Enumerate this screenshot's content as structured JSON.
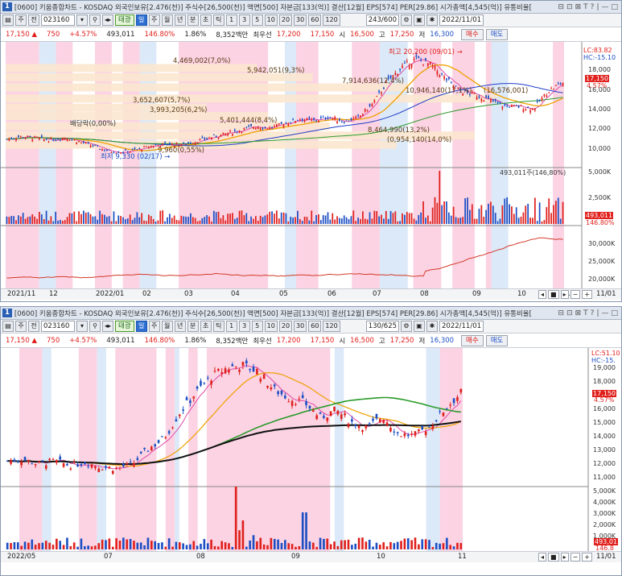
{
  "titlebar": {
    "num": "1",
    "text": "[0600] 키움종합차트 - KOSDAQ 외국인보유[2.476(천)] 주식수[26,500(천)] 액면[500] 자본금[133(억)] 결산[12월] EPS[574] PER[29.86] 시가총액[4,545(억)] 유통비율[",
    "controls": [
      "⊟",
      "⊡",
      "⊠",
      "T",
      "?",
      "|",
      "—",
      "□"
    ]
  },
  "toolbar": {
    "code": "023160",
    "name": "태광",
    "sys1": "주",
    "sys2": "전",
    "periods": [
      "일",
      "주",
      "월",
      "년",
      "분",
      "초",
      "틱"
    ],
    "minutes": [
      "1",
      "3",
      "5",
      "10",
      "20",
      "30",
      "60",
      "120"
    ],
    "date": "2022/11/01"
  },
  "toolbar1_count": "243/600",
  "toolbar2_count": "130/625",
  "quote": {
    "price": "17,150",
    "arrow": "▲",
    "change": "750",
    "pct": "+4.57%",
    "volume": "493,011",
    "vol_ratio": "146.80%",
    "turnover": "1.86%",
    "amount": "8,352백만",
    "best_ask_label": "최우선",
    "ask": "17,200",
    "bid": "17,150",
    "open_label": "시",
    "open": "16,500",
    "high_label": "고",
    "high": "17,250",
    "low_label": "저",
    "low": "16,300",
    "buy": "매수",
    "sell": "매도"
  },
  "chart1": {
    "annotations": {
      "high": "최고 20,200 (09/01) →",
      "low": "최저 9,330 (02/17) →",
      "dividend": "배당락(0,00%)",
      "lc": "LC:83.82",
      "hc": "HC:-15.10",
      "price_pct": "4.57%"
    },
    "volume_level_labels": [
      {
        "text": "4,469,002(7,0%)"
      },
      {
        "text": "5,942,051(9,3%)"
      },
      {
        "text": "7,914,636(12,4%)"
      },
      {
        "text": "10,946,140(17,1%)"
      },
      {
        "text": "(16,576,001)"
      },
      {
        "text": "3,652,607(5,7%)"
      },
      {
        "text": "3,993,205(6,2%)"
      },
      {
        "text": "5,401,444(8,4%)"
      },
      {
        "text": "8,464,990(13,2%)"
      },
      {
        "text": "(0,954,140(14,0%)"
      },
      {
        "text": "9,960(0,55%)"
      }
    ],
    "price_axis": [
      "18,000",
      "16,000",
      "14,000",
      "12,000",
      "10,000"
    ],
    "price_tag": "17,150",
    "volume_info": "493,011주(146,80%)",
    "volume_axis": [
      "5,000K",
      "2,500K"
    ],
    "volume_tag": "493,011",
    "volume_tag2": "146.80%",
    "obv_axis": [
      "30,000K",
      "25,000K",
      "20,000K"
    ],
    "date_axis": [
      "2021/11",
      "12",
      "2022/01",
      "02",
      "03",
      "04",
      "05",
      "06",
      "07",
      "08",
      "09",
      "10",
      "11",
      "11/01"
    ]
  },
  "chart2": {
    "price_axis": [
      "19,000",
      "18,000",
      "17,000",
      "16,000",
      "15,000",
      "14,000",
      "13,000",
      "12,000",
      "11,000"
    ],
    "lc": "LC:51.10",
    "hc": "HC:-15.",
    "price_tag": "17,150",
    "price_pct": "4.57%",
    "volume_axis": [
      "5,000K",
      "4,000K",
      "3,000K",
      "2,000K",
      "1,000K"
    ],
    "volume_tag": "493,01",
    "volume_tag2": "146.8",
    "date_axis": [
      "2022/05",
      "07",
      "08",
      "09",
      "10",
      "11",
      "11/01"
    ]
  },
  "chart_data": [
    {
      "type": "candlestick",
      "title": "태광 023160 일봉",
      "x_range": [
        "2021/11",
        "2022/11/01"
      ],
      "ylim": [
        9330,
        20200
      ],
      "key_points": {
        "low": {
          "date": "02/17",
          "value": 9330
        },
        "high": {
          "date": "09/01",
          "value": 20200
        },
        "last": 17150
      },
      "close_approx": [
        11000,
        11300,
        11100,
        10900,
        11200,
        10700,
        10200,
        9700,
        9600,
        9900,
        10300,
        10500,
        10400,
        10800,
        11200,
        11600,
        12000,
        12400,
        12200,
        12700,
        13200,
        13000,
        13400,
        12900,
        13300,
        14800,
        17200,
        18800,
        19700,
        19000,
        17500,
        16200,
        15800,
        15200,
        14600,
        14500,
        14300,
        16200,
        17150
      ],
      "volume_axis": [
        "5,000K",
        "2,500K"
      ],
      "obv_axis": [
        "30,000K",
        "25,000K",
        "20,000K"
      ]
    },
    {
      "type": "candlestick",
      "title": "태광 023160 일봉 (2022/05~)",
      "x_range": [
        "2022/05",
        "2022/11/01"
      ],
      "ylim": [
        11000,
        19500
      ],
      "close_approx": [
        12600,
        12700,
        12400,
        12600,
        12300,
        12500,
        12200,
        12100,
        12400,
        13400,
        14100,
        15800,
        17100,
        18200,
        18800,
        19000,
        18600,
        17400,
        16800,
        16500,
        15500,
        16000,
        15200,
        14800,
        15600,
        14400,
        14300,
        14900,
        16100,
        17150
      ],
      "volume_axis": [
        "5,000K",
        "4,000K",
        "3,000K",
        "2,000K",
        "1,000K"
      ]
    }
  ]
}
